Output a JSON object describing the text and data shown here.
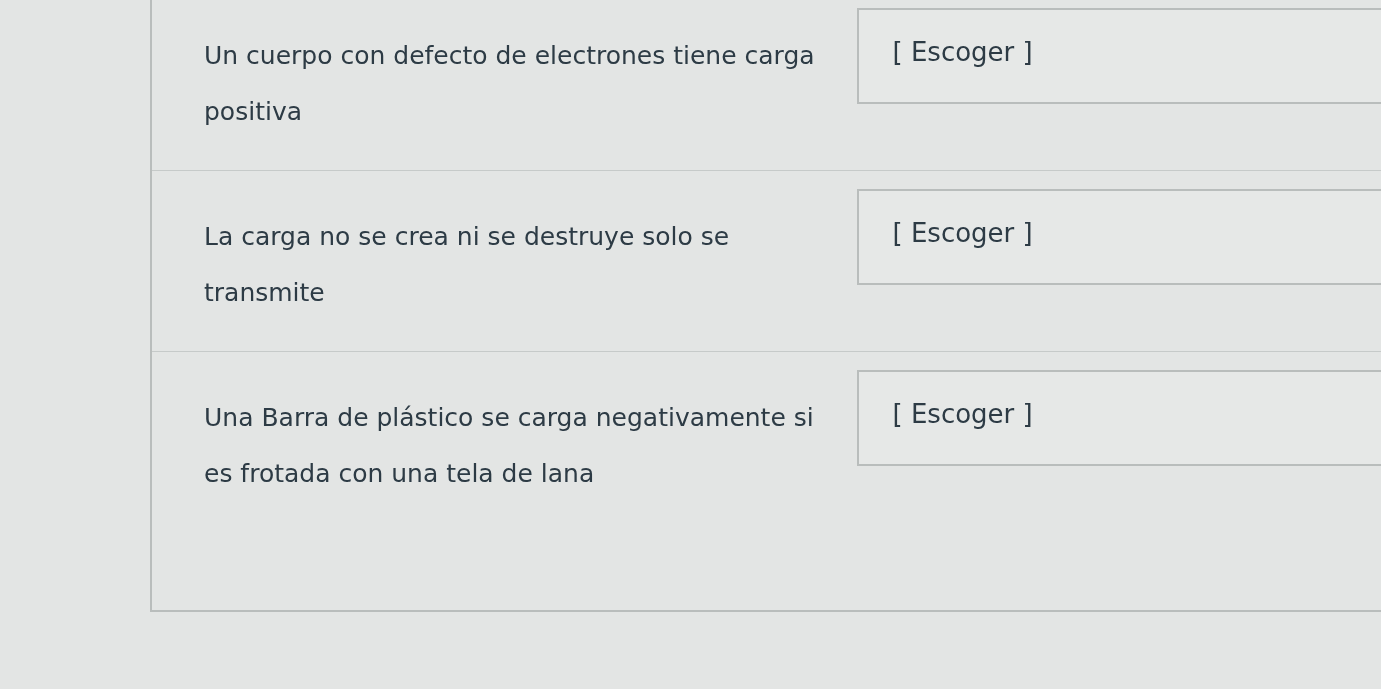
{
  "questions": [
    {
      "text": "Un cuerpo con defecto de electrones tiene carga positiva",
      "answer": "[ Escoger ]"
    },
    {
      "text": "La carga no se crea ni se destruye solo se transmite",
      "answer": "[ Escoger ]"
    },
    {
      "text": "Una Barra de plástico se carga negativamente si es frotada con una tela de lana",
      "answer": "[ Escoger ]"
    }
  ]
}
